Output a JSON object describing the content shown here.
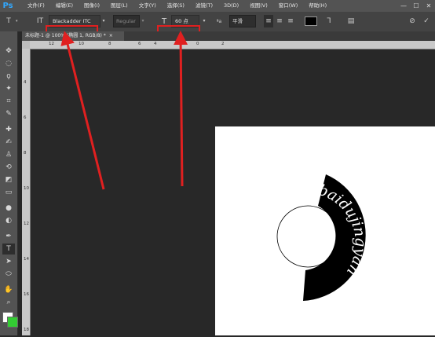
{
  "app": {
    "logo": "Ps"
  },
  "menu": [
    "文件(F)",
    "编辑(E)",
    "图像(I)",
    "图层(L)",
    "文字(Y)",
    "选择(S)",
    "滤镜(T)",
    "3D(D)",
    "视图(V)",
    "窗口(W)",
    "帮助(H)"
  ],
  "window_controls": {
    "minimize": "—",
    "maximize": "☐",
    "close": "✕"
  },
  "options": {
    "font_family": "Blackadder ITC",
    "font_style": "Regular",
    "font_size": "60 点",
    "antialias": "平滑",
    "text_color": "#000000"
  },
  "document": {
    "tab_title": "未标题-1 @ 100% (椭圆 1, RGB/8) *",
    "tab_close": "×"
  },
  "ruler_h": [
    "12",
    "10",
    "8",
    "6",
    "4",
    "2",
    "0",
    "2"
  ],
  "ruler_v": [
    "4",
    "6",
    "8",
    "10",
    "12",
    "14",
    "16",
    "18"
  ],
  "canvas_text": "baidujingyan",
  "colors": {
    "annotation": "#e02020",
    "foreground": "#ffffff",
    "background": "#33cc33"
  }
}
